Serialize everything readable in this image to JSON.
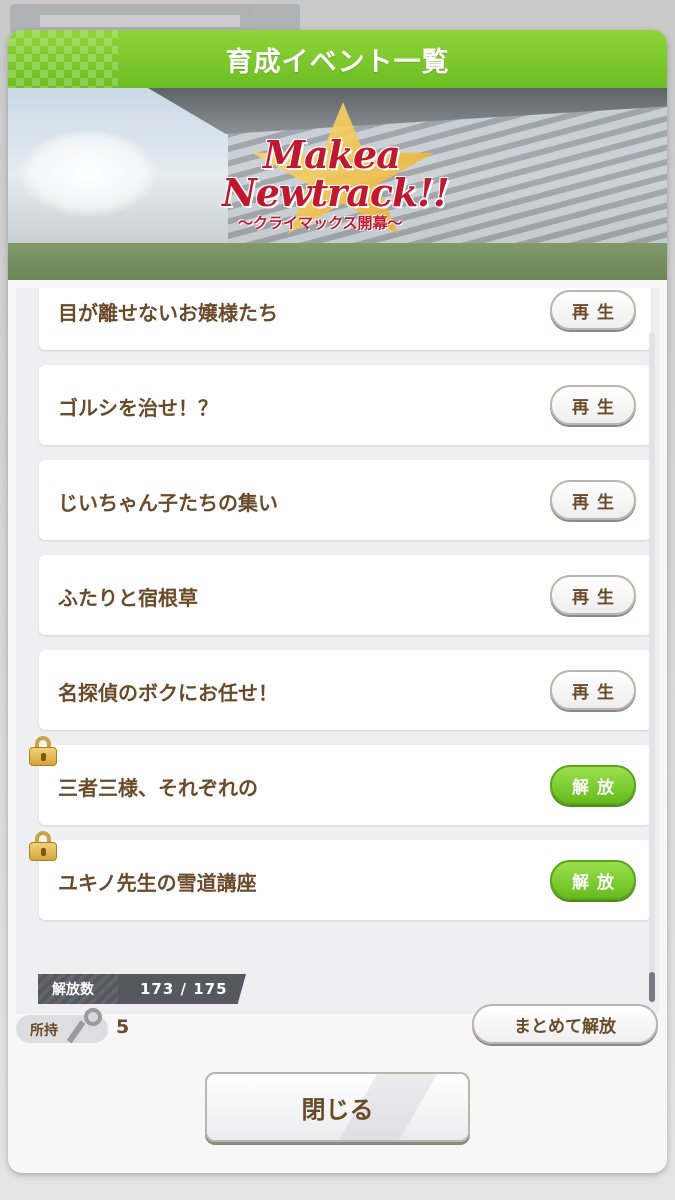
{
  "background": {
    "tab_label": ""
  },
  "header": {
    "title": "育成イベント一覧"
  },
  "banner": {
    "logo_line1": "Makea",
    "logo_line2": "Newtrack!!",
    "logo_subtitle": "〜クライマックス開幕〜"
  },
  "events": [
    {
      "title": "目が離せないお嬢様たち",
      "button": "再生",
      "locked": false
    },
    {
      "title": "ゴルシを治せ！？",
      "button": "再生",
      "locked": false
    },
    {
      "title": "じいちゃん子たちの集い",
      "button": "再生",
      "locked": false
    },
    {
      "title": "ふたりと宿根草",
      "button": "再生",
      "locked": false
    },
    {
      "title": "名探偵のボクにお任せ！",
      "button": "再生",
      "locked": false
    },
    {
      "title": "三者三様、それぞれの",
      "button": "解放",
      "locked": true
    },
    {
      "title": "ユキノ先生の雪道講座",
      "button": "解放",
      "locked": true
    }
  ],
  "unlock_count": {
    "label": "解放数",
    "value": "173 / 175"
  },
  "owned": {
    "label": "所持",
    "icon": "key-icon",
    "value": "5"
  },
  "bulk_unlock_label": "まとめて解放",
  "close_label": "閉じる",
  "colors": {
    "header_green": "#7ccb2e",
    "text_brown": "#6b4a2a",
    "unlock_green": "#66bb1e",
    "logo_red": "#c0182e"
  }
}
